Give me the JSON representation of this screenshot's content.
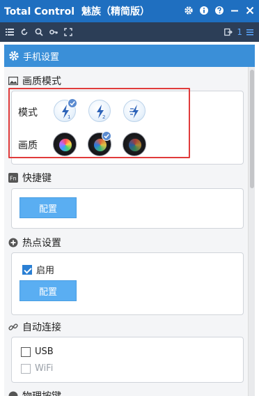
{
  "window": {
    "app_name": "Total Control",
    "device_name": "魅族（精简版）"
  },
  "toolbar": {
    "device_count": "1"
  },
  "panel": {
    "title": "手机设置"
  },
  "quality_mode": {
    "section_title": "画质模式",
    "mode_label": "模式",
    "quality_label": "画质",
    "selected_mode_index": 0,
    "selected_quality_index": 1
  },
  "shortcut": {
    "section_title": "快捷键",
    "config_label": "配置"
  },
  "hotspot": {
    "section_title": "热点设置",
    "enable_label": "启用",
    "enable_checked": true,
    "config_label": "配置"
  },
  "auto_connect": {
    "section_title": "自动连接",
    "usb_label": "USB",
    "usb_checked": false,
    "wifi_label": "WiFi",
    "wifi_checked": false,
    "wifi_disabled": true
  },
  "physical_keys": {
    "section_title": "物理按键"
  },
  "colors": {
    "titlebar": "#1f6fc0",
    "toolbar": "#2c3e57",
    "panel_header": "#3a8fd8",
    "button": "#5aaef2",
    "highlight": "#e03b3b"
  }
}
